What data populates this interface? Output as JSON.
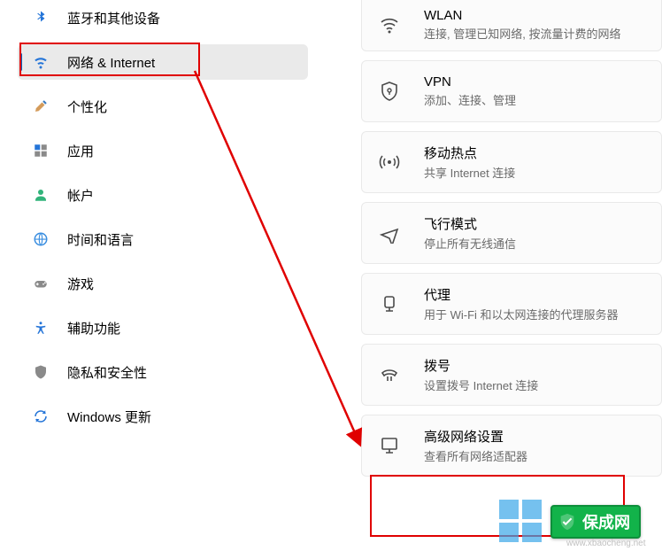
{
  "sidebar": {
    "items": [
      {
        "label": "蓝牙和其他设备",
        "icon": "bluetooth"
      },
      {
        "label": "网络 & Internet",
        "icon": "wifi",
        "selected": true
      },
      {
        "label": "个性化",
        "icon": "brush"
      },
      {
        "label": "应用",
        "icon": "apps"
      },
      {
        "label": "帐户",
        "icon": "person"
      },
      {
        "label": "时间和语言",
        "icon": "globe"
      },
      {
        "label": "游戏",
        "icon": "gamepad"
      },
      {
        "label": "辅助功能",
        "icon": "accessibility"
      },
      {
        "label": "隐私和安全性",
        "icon": "shield"
      },
      {
        "label": "Windows 更新",
        "icon": "sync"
      }
    ]
  },
  "main": {
    "tiles": [
      {
        "title": "WLAN",
        "sub": "连接, 管理已知网络, 按流量计费的网络",
        "icon": "wifi"
      },
      {
        "title": "VPN",
        "sub": "添加、连接、管理",
        "icon": "vpn-shield"
      },
      {
        "title": "移动热点",
        "sub": "共享 Internet 连接",
        "icon": "hotspot"
      },
      {
        "title": "飞行模式",
        "sub": "停止所有无线通信",
        "icon": "airplane"
      },
      {
        "title": "代理",
        "sub": "用于 Wi-Fi 和以太网连接的代理服务器",
        "icon": "proxy"
      },
      {
        "title": "拨号",
        "sub": "设置拨号 Internet 连接",
        "icon": "dialup"
      },
      {
        "title": "高级网络设置",
        "sub": "查看所有网络适配器",
        "icon": "monitor"
      }
    ]
  },
  "watermark": {
    "text": "保成网",
    "url": "www.xbaocheng.net"
  },
  "icon_colors": {
    "bluetooth": "#2575d8",
    "wifi_selected": "#2575d8",
    "brush": "#d49b5a",
    "apps": "#2575d8",
    "person": "#31b37a",
    "globe": "#3a8ee0",
    "sync": "#2575d8",
    "outline": "#4a4a4a"
  }
}
